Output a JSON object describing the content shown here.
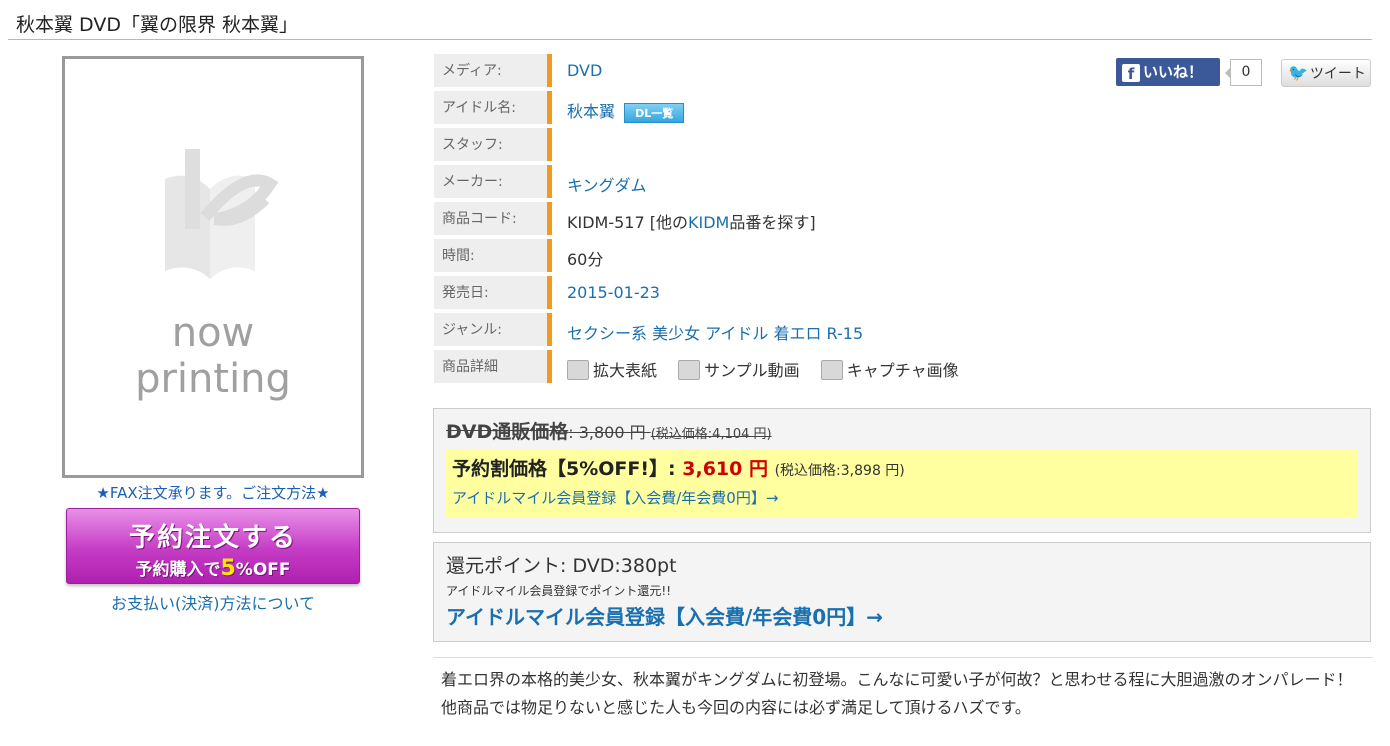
{
  "title": "秋本翼  DVD「翼の限界 秋本翼」",
  "cover": {
    "line1": "now",
    "line2": "printing"
  },
  "fax_text": "★FAX注文承ります。ご注文方法★",
  "order_button": {
    "line1": "予約注文する",
    "line2_prefix": "予約購入で",
    "line2_pct": "5",
    "line2_suffix": "%OFF"
  },
  "payment_link": "お支払い(決済)方法について",
  "info": [
    {
      "label": "メディア:",
      "value": "DVD",
      "link": true
    },
    {
      "label": "アイドル名:",
      "value": "秋本翼",
      "link": true,
      "badge": "DL一覧"
    },
    {
      "label": "スタッフ:",
      "value": ""
    },
    {
      "label": "メーカー:",
      "value": "キングダム",
      "link": true
    },
    {
      "label": "商品コード:",
      "value_prefix": "KIDM-517 [他の",
      "value_link": "KIDM",
      "value_suffix": "品番を探す]"
    },
    {
      "label": "時間:",
      "value": "60分"
    },
    {
      "label": "発売日:",
      "value": "2015-01-23",
      "link": true
    },
    {
      "label": "ジャンル:",
      "value": "セクシー系 美少女 アイドル 着エロ R-15",
      "link": true
    },
    {
      "label": "商品詳細",
      "details": [
        "拡大表紙",
        "サンプル動画",
        "キャプチャ画像"
      ]
    }
  ],
  "social": {
    "like": "いいね！",
    "like_count": "0",
    "tweet": "ツイート"
  },
  "price": {
    "normal_label": "DVD通販価格",
    "normal_value": ": 3,800 円",
    "normal_tax": "(税込価格:4,104 円)",
    "sale_label": "予約割価格【5%OFF!】: ",
    "sale_value": "3,610 円",
    "sale_tax": "(税込価格:3,898 円)",
    "register": "アイドルマイル会員登録【入会費/年会費0円】→"
  },
  "points": {
    "text": "還元ポイント: DVD:380pt",
    "note": "アイドルマイル会員登録でポイント還元!!",
    "register": "アイドルマイル会員登録【入会費/年会費0円】→"
  },
  "description": "着エロ界の本格的美少女、秋本翼がキングダムに初登場。こんなに可愛い子が何故？と思わせる程に大胆過激のオンパレード！他商品では物足りないと感じた人も今回の内容には必ず満足して頂けるハズです。"
}
